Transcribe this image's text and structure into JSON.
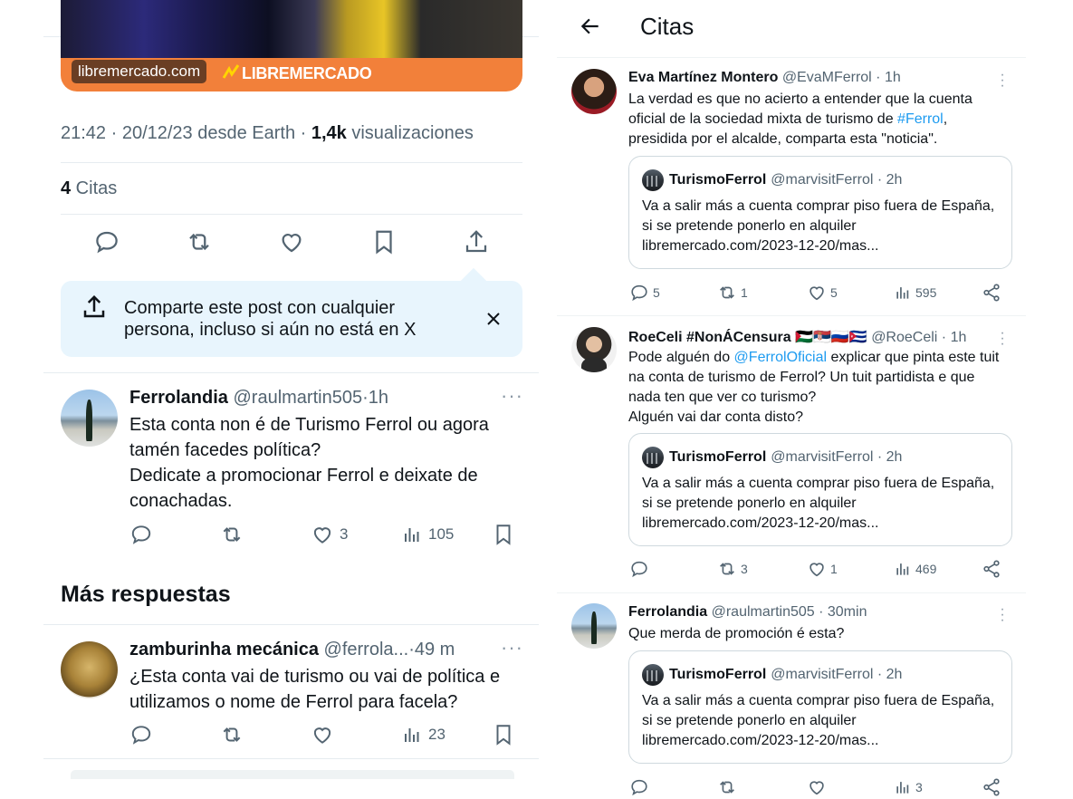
{
  "left": {
    "link_card": {
      "domain": "libremercado.com",
      "brand": "LIBREMERCADO"
    },
    "post_meta": {
      "time_date_source": "21:42 · 20/12/23 desde Earth · ",
      "views_count": "1,4k",
      "views_label": " visualizaciones"
    },
    "quotes_row": {
      "count": "4",
      "label": " Citas"
    },
    "share_prompt": {
      "text": "Comparte este post con cualquier persona, incluso si aún no está en X"
    },
    "replies": [
      {
        "name": "Ferrolandia",
        "handle": "@raulmartin505",
        "time": "·1h",
        "text": "Esta conta non é de Turismo Ferrol ou agora tamén facedes política?\nDedicate a promocionar Ferrol e deixate de conachadas.",
        "likes": "3",
        "views": "105"
      }
    ],
    "more_replies_title": "Más respuestas",
    "more_replies": [
      {
        "name": "zamburinha mecánica",
        "handle": "@ferrola...",
        "time": "·49 m",
        "text": "¿Esta conta vai de turismo ou vai de política e utilizamos o nome de Ferrol para facela?",
        "likes": "",
        "views": "23"
      }
    ]
  },
  "right": {
    "header_title": "Citas",
    "quote_tweet": {
      "name": "TurismoFerrol",
      "handle": "@marvisitFerrol · 2h",
      "text_a": "Va a salir más a cuenta comprar piso fuera de España, si se pretende ponerlo en alquiler libremercado.com/2023-12-20/mas...",
      "text_b": "Va a salir más a cuenta comprar piso fuera de España, si se pretende ponerlo en alquiler libremercado.com/2023-12-20/mas..."
    },
    "posts": [
      {
        "name": "Eva Martínez Montero",
        "handle": "@EvaMFerrol · 1h",
        "text_1": "La verdad es que no acierto a entender que la cuenta oficial de la sociedad mixta de turismo de ",
        "link": "#Ferrol",
        "text_2": ", presidida por el alcalde, comparta esta \"noticia\".",
        "replies": "5",
        "reposts": "1",
        "likes": "5",
        "views": "595"
      },
      {
        "name": "RoeCeli #NonÁCensura 🇵🇸🇷🇸🇷🇺🇨🇺",
        "handle": "@RoeCeli · 1h",
        "text_1": "Pode alguén do ",
        "link": "@FerrolOficial",
        "text_2": " explicar que pinta este tuit na conta de turismo de Ferrol? Un tuit partidista e que nada ten que ver co turismo?\nAlguén vai dar conta disto?",
        "replies": "",
        "reposts": "3",
        "likes": "1",
        "views": "469"
      },
      {
        "name": "Ferrolandia",
        "handle": "@raulmartin505 · 30min",
        "text_1": "Que merda de promoción é esta?",
        "link": "",
        "text_2": "",
        "replies": "",
        "reposts": "",
        "likes": "",
        "views": "3"
      }
    ]
  },
  "colors": {
    "accent": "#1d9bf0",
    "muted": "#536471",
    "share_bg": "#e8f5fd",
    "brand_orange": "#f2803a"
  }
}
